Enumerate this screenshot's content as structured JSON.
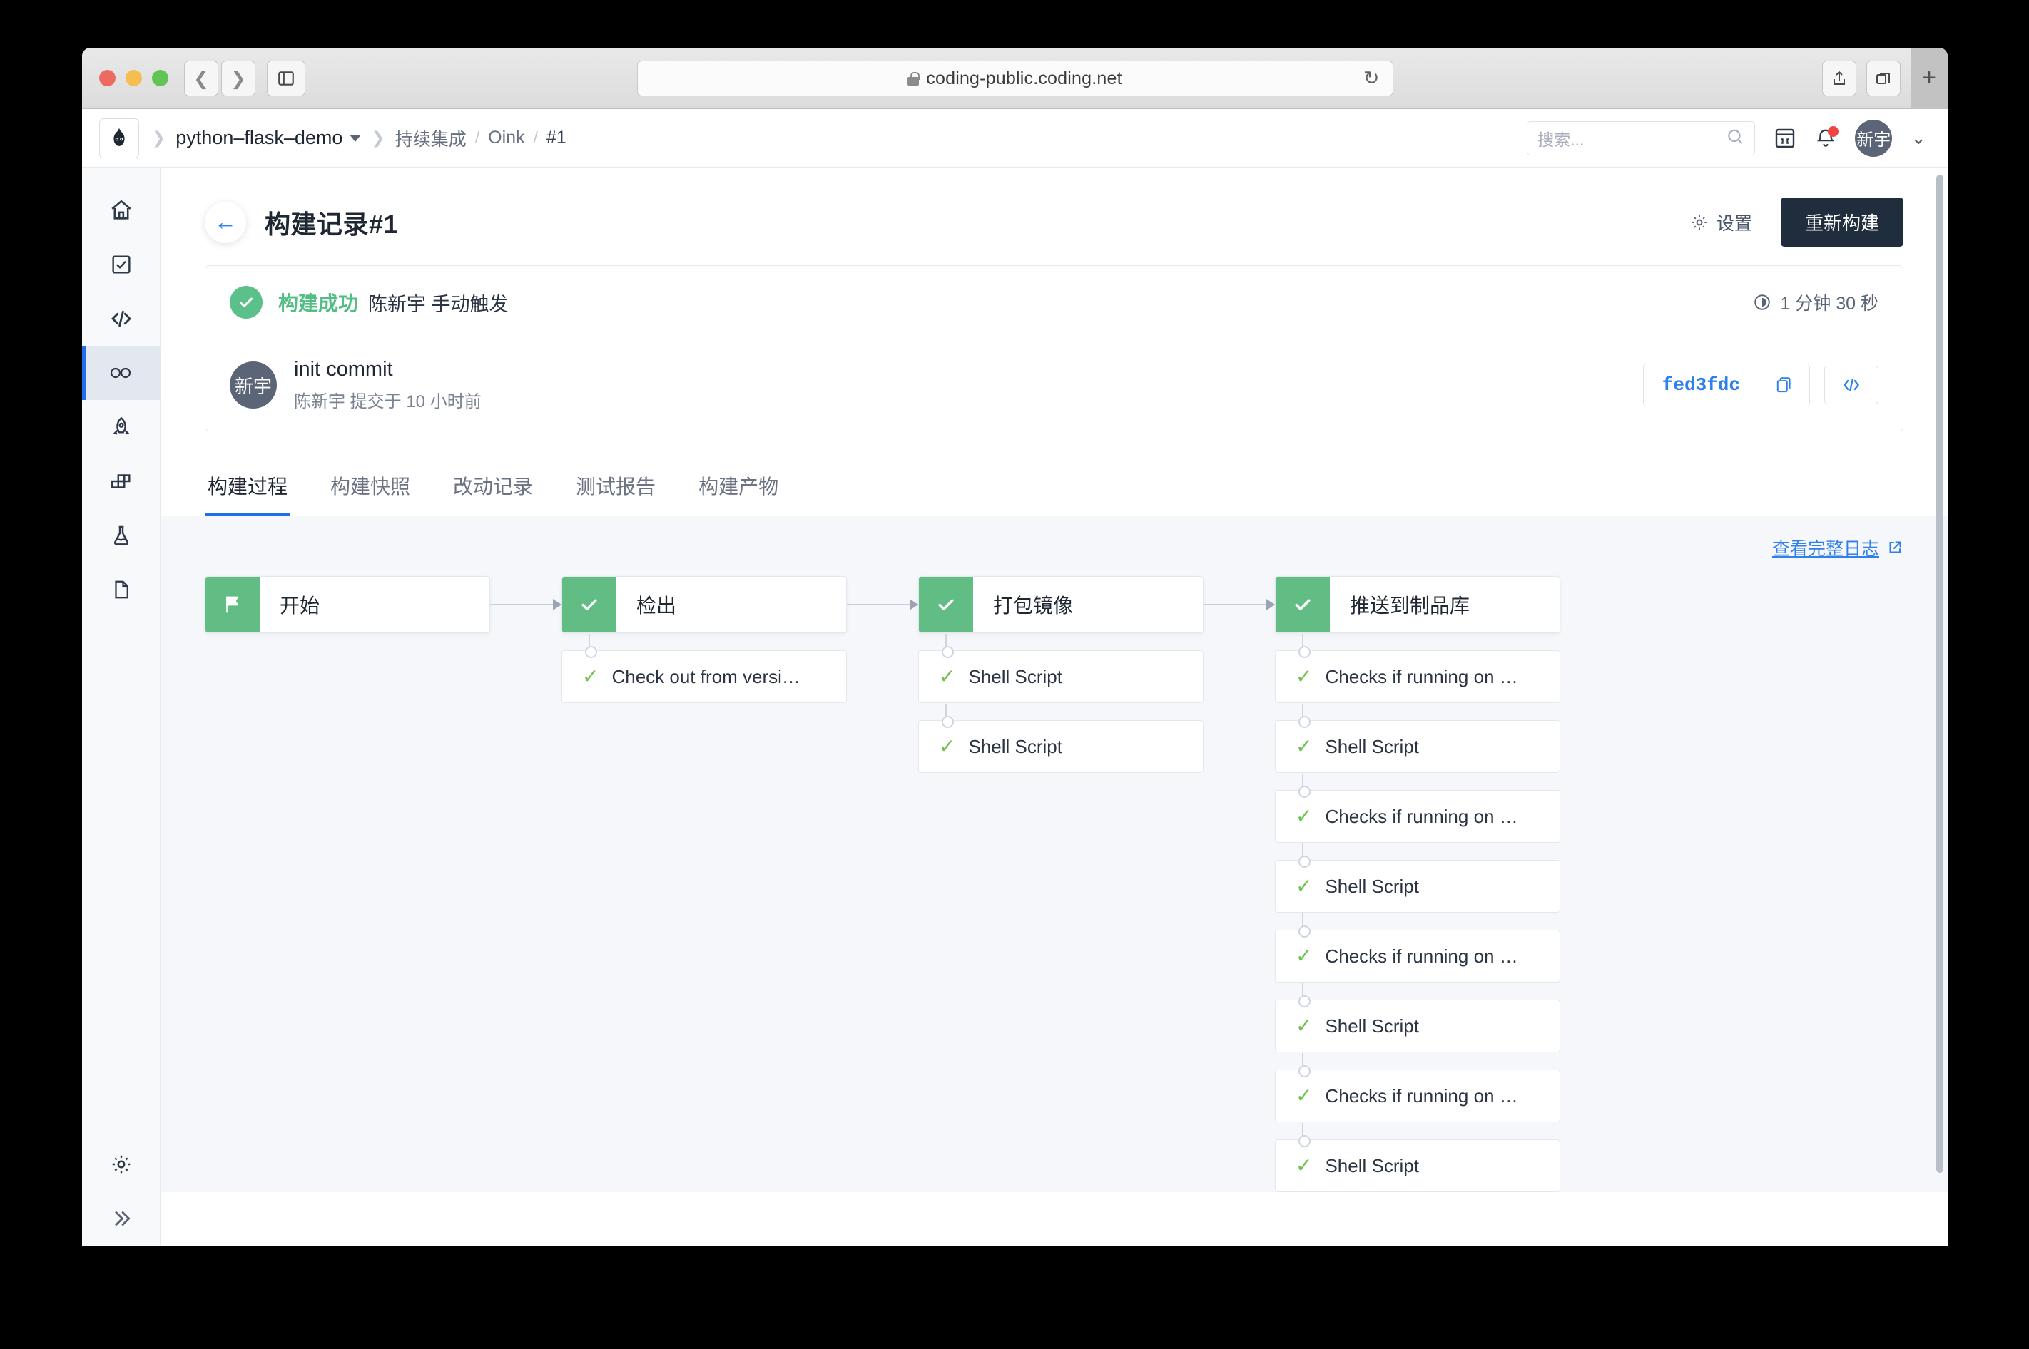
{
  "browser": {
    "url": "coding-public.coding.net",
    "back_icon": "chevron-left-icon",
    "forward_icon": "chevron-right-icon",
    "sidebar_icon": "sidebar-toggle-icon",
    "reload_icon": "reload-icon",
    "share_icon": "share-icon",
    "tabs_icon": "tab-overview-icon",
    "new_tab_label": "+"
  },
  "header": {
    "breadcrumb": {
      "project": "python–flask–demo",
      "section": "持续集成",
      "pipeline": "Oink",
      "build": "#1"
    },
    "search": {
      "placeholder": "搜索...",
      "value": ""
    },
    "terminal_icon": "terminal-icon",
    "bell_icon": "bell-icon",
    "avatar_initials": "新宇"
  },
  "sidebar": {
    "items": [
      {
        "name": "home",
        "icon": "home-icon"
      },
      {
        "name": "tasks",
        "icon": "checkbox-icon"
      },
      {
        "name": "code",
        "icon": "code-icon"
      },
      {
        "name": "ci-cd",
        "icon": "infinity-icon",
        "active": true
      },
      {
        "name": "deploy",
        "icon": "rocket-icon"
      },
      {
        "name": "artifacts",
        "icon": "blocks-icon"
      },
      {
        "name": "testing",
        "icon": "flask-icon"
      },
      {
        "name": "docs",
        "icon": "document-icon"
      }
    ],
    "bottom": [
      {
        "name": "settings",
        "icon": "gear-icon"
      },
      {
        "name": "expand",
        "icon": "double-chevron-right-icon"
      }
    ]
  },
  "page": {
    "title": "构建记录#1",
    "back_icon": "arrow-left-icon",
    "settings_label": "设置",
    "settings_icon": "gear-icon",
    "rebuild_label": "重新构建"
  },
  "summary": {
    "status_icon": "check-circle-icon",
    "status_text": "构建成功",
    "trigger_text": "陈新宇 手动触发",
    "duration_icon": "clock-icon",
    "duration_text": "1 分钟 30 秒",
    "status_color": "#52bd85",
    "commit": {
      "avatar_initials": "新宇",
      "message": "init commit",
      "meta": "陈新宇 提交于 10 小时前",
      "hash": "fed3fdc",
      "copy_icon": "copy-icon",
      "code_icon": "code-brackets-icon"
    }
  },
  "tabs": [
    {
      "label": "构建过程",
      "active": true
    },
    {
      "label": "构建快照",
      "active": false
    },
    {
      "label": "改动记录",
      "active": false
    },
    {
      "label": "测试报告",
      "active": false
    },
    {
      "label": "构建产物",
      "active": false
    }
  ],
  "pipeline": {
    "log_link": "查看完整日志",
    "log_link_icon": "external-link-icon",
    "stages": [
      {
        "label": "开始",
        "icon": "flag-icon",
        "status_color": "#62bd84",
        "tasks": []
      },
      {
        "label": "检出",
        "icon": "check-icon",
        "status_color": "#62bd84",
        "tasks": [
          {
            "name": "Check out from versi…",
            "icon": "check-icon"
          }
        ]
      },
      {
        "label": "打包镜像",
        "icon": "check-icon",
        "status_color": "#62bd84",
        "tasks": [
          {
            "name": "Shell Script",
            "icon": "check-icon"
          },
          {
            "name": "Shell Script",
            "icon": "check-icon"
          }
        ]
      },
      {
        "label": "推送到制品库",
        "icon": "check-icon",
        "status_color": "#62bd84",
        "tasks": [
          {
            "name": "Checks if running on …",
            "icon": "check-icon"
          },
          {
            "name": "Shell Script",
            "icon": "check-icon"
          },
          {
            "name": "Checks if running on …",
            "icon": "check-icon"
          },
          {
            "name": "Shell Script",
            "icon": "check-icon"
          },
          {
            "name": "Checks if running on …",
            "icon": "check-icon"
          },
          {
            "name": "Shell Script",
            "icon": "check-icon"
          },
          {
            "name": "Checks if running on …",
            "icon": "check-icon"
          },
          {
            "name": "Shell Script",
            "icon": "check-icon"
          }
        ]
      }
    ]
  }
}
